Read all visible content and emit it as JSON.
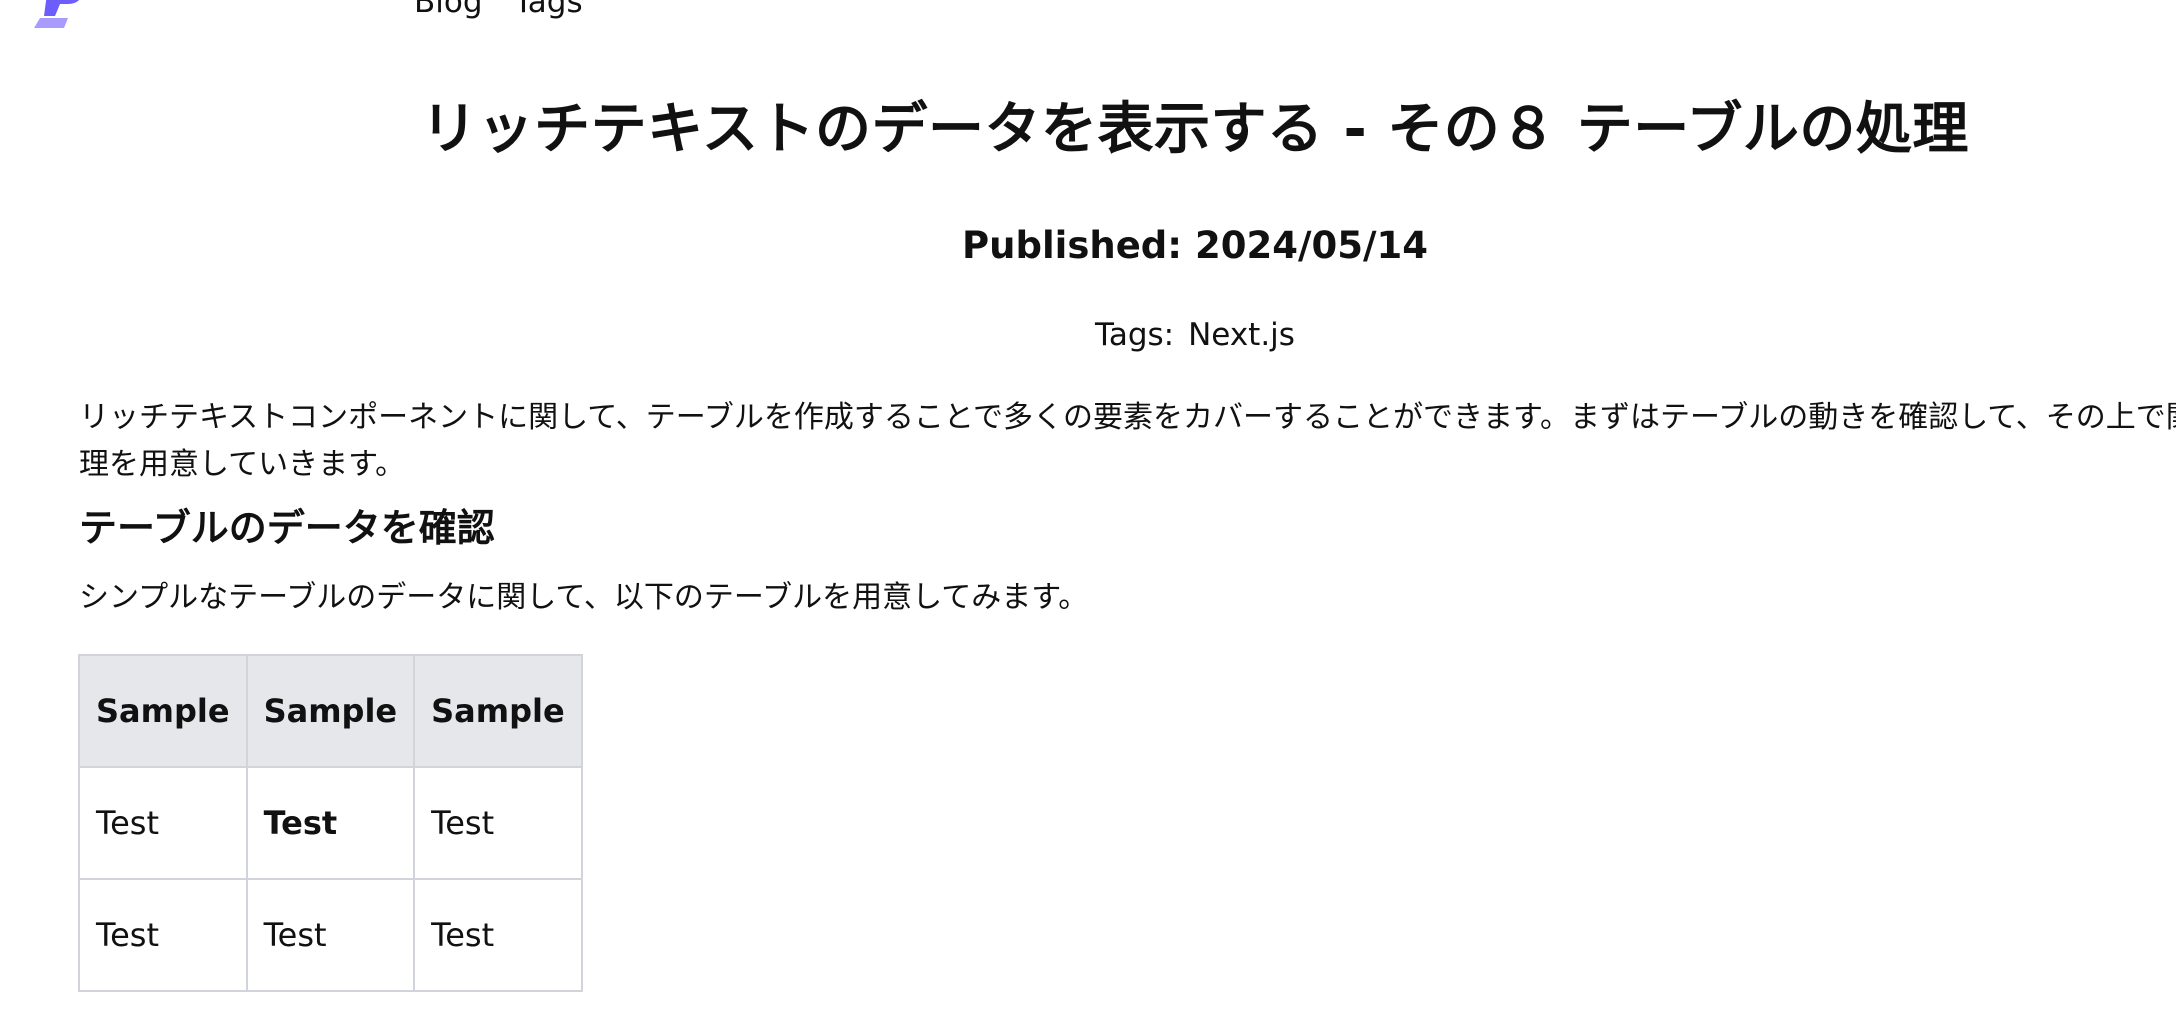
{
  "brand": {
    "logo_icon": "brand-logo-icon",
    "logo_color": "#6d5dfc"
  },
  "nav": {
    "blog_label": "Blog",
    "tags_label": "Tags"
  },
  "article": {
    "title": "リッチテキストのデータを表示する - その８ テーブルの処理",
    "published": "Published: 2024/05/14",
    "tags_label": "Tags:",
    "tags": [
      "Next.js"
    ],
    "intro_line1": "リッチテキストコンポーネントに関して、テーブルを作成することで多くの要素をカバーすることができます。まずはテーブルの動きを確認して、その上で関",
    "intro_line2": "理を用意していきます。",
    "section_heading": "テーブルのデータを確認",
    "section_text": "シンプルなテーブルのデータに関して、以下のテーブルを用意してみます。"
  },
  "table": {
    "headers": [
      "Sample",
      "Sample",
      "Sample"
    ],
    "rows": [
      [
        "Test",
        "Test",
        "Test"
      ],
      [
        "Test",
        "Test",
        "Test"
      ]
    ],
    "header_bg": "#e5e7eb",
    "border_color": "#d1d5db"
  }
}
